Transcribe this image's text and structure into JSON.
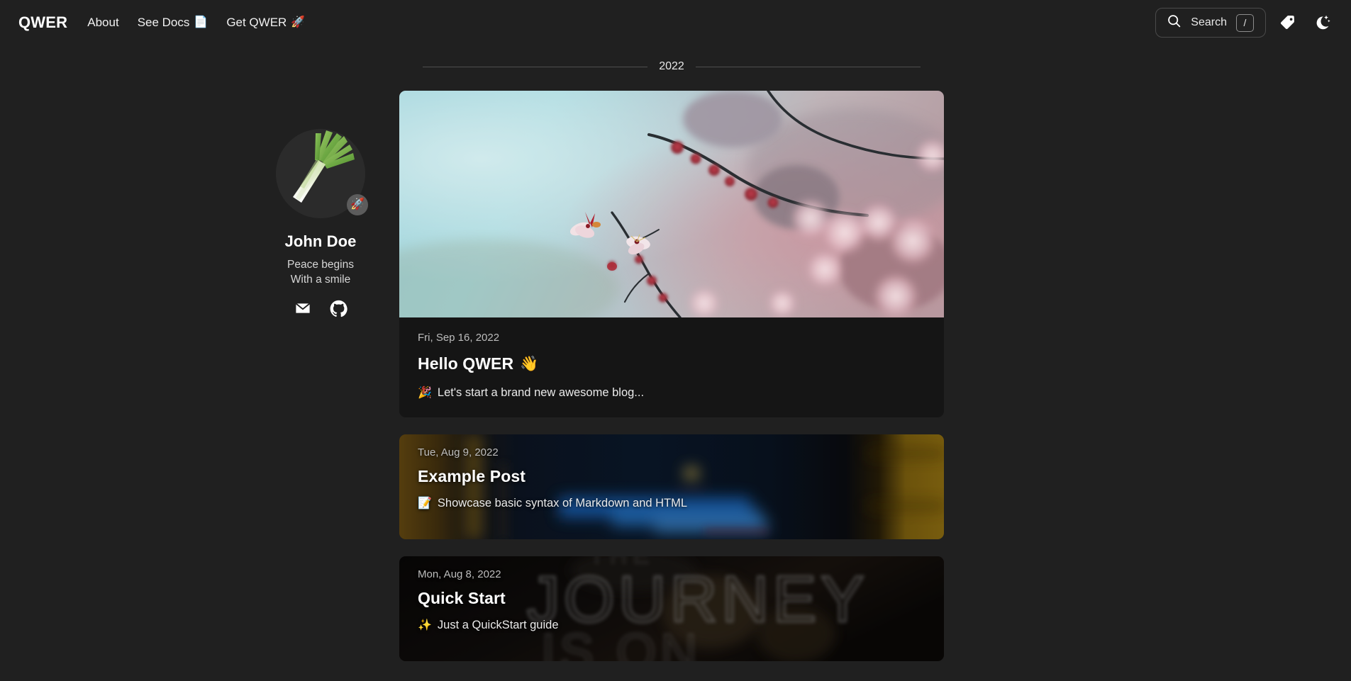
{
  "navbar": {
    "brand": "QWER",
    "links": [
      {
        "label": "About",
        "emoji": ""
      },
      {
        "label": "See Docs",
        "emoji": "📄"
      },
      {
        "label": "Get QWER",
        "emoji": "🚀"
      }
    ],
    "search": {
      "label": "Search",
      "shortcut": "/",
      "icon": "search-icon"
    },
    "tags_icon": "tag-icon",
    "theme_icon": "moon-icon"
  },
  "profile": {
    "avatar_alt": "leek-avatar",
    "badge_emoji": "🚀",
    "name": "John Doe",
    "bio_line1": "Peace begins",
    "bio_line2": "With a smile",
    "socials": [
      {
        "name": "email",
        "icon": "mail-icon"
      },
      {
        "name": "github",
        "icon": "github-icon"
      }
    ]
  },
  "main": {
    "year": "2022",
    "posts": [
      {
        "date": "Fri, Sep 16, 2022",
        "title": "Hello QWER",
        "title_emoji": "👋",
        "desc": "Let's start a brand new awesome blog...",
        "desc_emoji": "🎉",
        "layout": "hero",
        "cover": "cherry-blossom"
      },
      {
        "date": "Tue, Aug 9, 2022",
        "title": "Example Post",
        "title_emoji": "",
        "desc": "Showcase basic syntax of Markdown and HTML",
        "desc_emoji": "📝",
        "layout": "compact",
        "cover": "night-city-blur"
      },
      {
        "date": "Mon, Aug 8, 2022",
        "title": "Quick Start",
        "title_emoji": "",
        "desc": "Just a QuickStart guide",
        "desc_emoji": "✨",
        "layout": "compact",
        "cover": "journey-sign-blur"
      }
    ]
  },
  "colors": {
    "page_bg": "#202020",
    "card_bg": "#151515",
    "text": "#ffffff",
    "muted": "#bdbdbd",
    "divider": "#4f4f4f"
  }
}
